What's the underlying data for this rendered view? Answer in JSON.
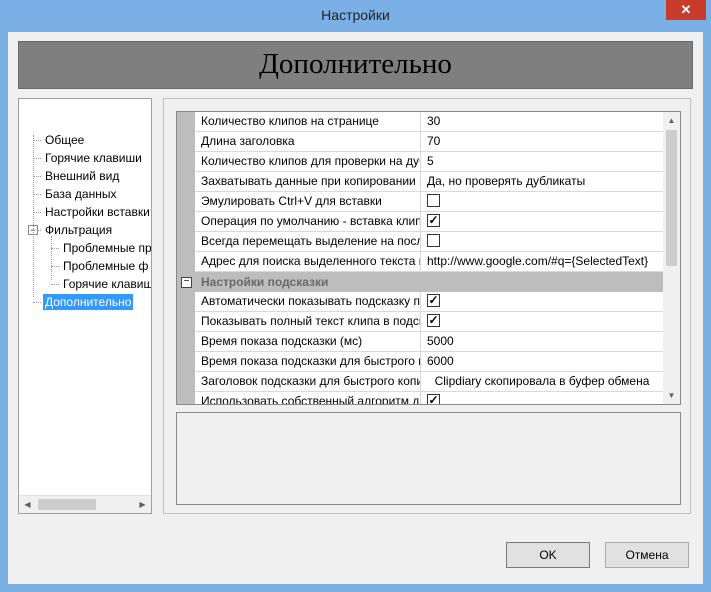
{
  "window": {
    "title": "Настройки",
    "close_glyph": "✕"
  },
  "header": {
    "title": "Дополнительно"
  },
  "tree": {
    "items": [
      {
        "label": "Общее",
        "level": 0,
        "selected": false
      },
      {
        "label": "Горячие клавиши",
        "level": 0,
        "selected": false
      },
      {
        "label": "Внешний вид",
        "level": 0,
        "selected": false
      },
      {
        "label": "База данных",
        "level": 0,
        "selected": false
      },
      {
        "label": "Настройки вставки",
        "level": 0,
        "selected": false
      },
      {
        "label": "Фильтрация",
        "level": 0,
        "selected": false,
        "expanded": true
      },
      {
        "label": "Проблемные пр",
        "level": 1,
        "selected": false
      },
      {
        "label": "Проблемные ф",
        "level": 1,
        "selected": false
      },
      {
        "label": "Горячие клавиш",
        "level": 1,
        "selected": false
      },
      {
        "label": "Дополнительно",
        "level": 0,
        "selected": true
      }
    ],
    "expander_glyph": "−"
  },
  "properties": {
    "rows": [
      {
        "name": "Количество клипов на странице",
        "value": "30",
        "type": "text"
      },
      {
        "name": "Длина заголовка",
        "value": "70",
        "type": "text"
      },
      {
        "name": "Количество клипов для проверки на дубли",
        "value": "5",
        "type": "text"
      },
      {
        "name": "Захватывать данные при копировании в",
        "value": "Да, но проверять дубликаты",
        "type": "text"
      },
      {
        "name": "Эмулировать Ctrl+V для вставки",
        "value": "",
        "type": "checkbox",
        "checked": false
      },
      {
        "name": "Операция по умолчанию - вставка клипа",
        "value": "",
        "type": "checkbox",
        "checked": true
      },
      {
        "name": "Всегда перемещать выделение на последний",
        "value": "",
        "type": "checkbox",
        "checked": false
      },
      {
        "name": "Адрес для поиска выделенного текста в",
        "value": "http://www.google.com/#q={SelectedText}",
        "type": "text"
      }
    ],
    "category": {
      "label": "Настройки подсказки",
      "toggle_glyph": "−"
    },
    "rows2": [
      {
        "name": "Автоматически показывать подсказку при",
        "value": "",
        "type": "checkbox",
        "checked": true
      },
      {
        "name": "Показывать полный текст клипа в подсказке",
        "value": "",
        "type": "checkbox",
        "checked": true
      },
      {
        "name": "Время показа подсказки (мс)",
        "value": "5000",
        "type": "text"
      },
      {
        "name": "Время показа подсказки для быстрого копирования",
        "value": "6000",
        "type": "text"
      },
      {
        "name": "Заголовок подсказки для быстрого копирования",
        "value": "Clipdiary скопировала в буфер обмена",
        "type": "text",
        "centered": true
      },
      {
        "name": "Использовать собственный алгоритм для",
        "value": "",
        "type": "checkbox",
        "checked": true
      }
    ],
    "check_glyph": "✓"
  },
  "scroll": {
    "up": "▲",
    "down": "▼",
    "left": "◀",
    "right": "▶"
  },
  "buttons": {
    "ok": "OK",
    "cancel": "Отмена"
  }
}
